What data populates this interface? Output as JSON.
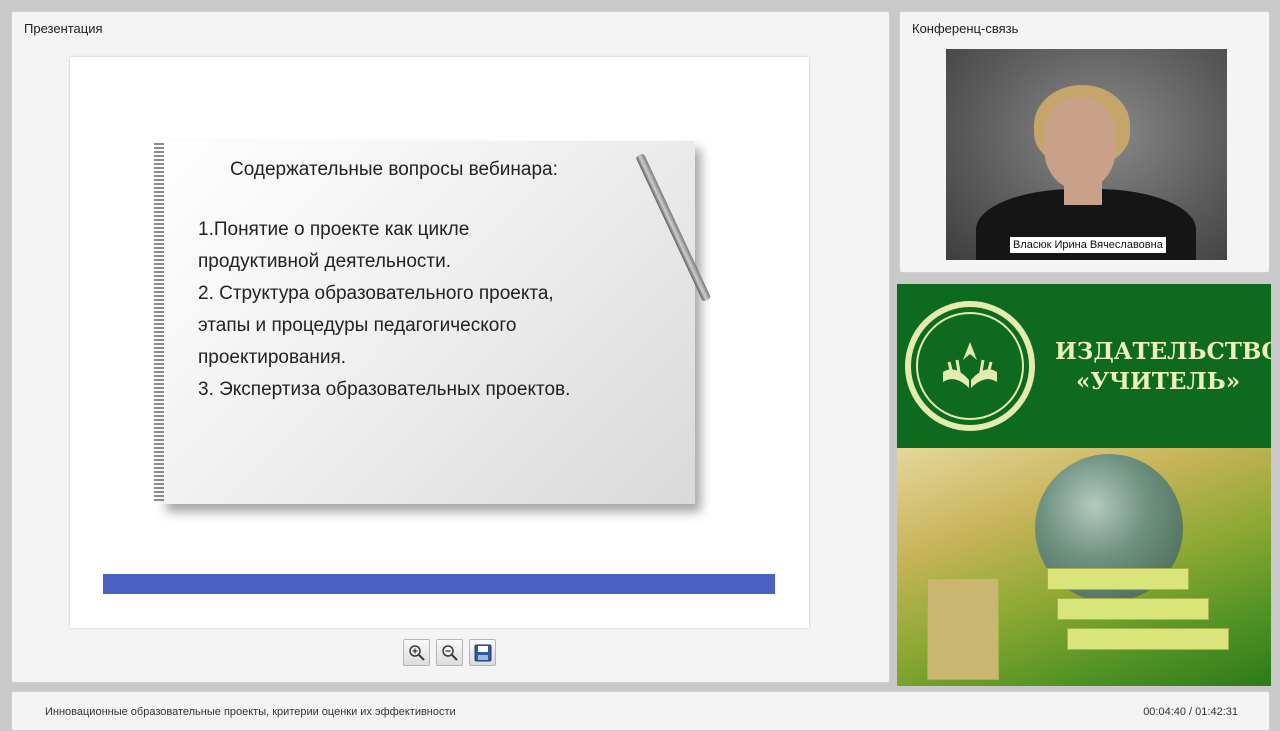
{
  "presentation": {
    "title": "Презентация"
  },
  "slide": {
    "heading": "Содержательные вопросы вебинара:",
    "lines": [
      "1.Понятие о проекте как цикле",
      "продуктивной деятельности.",
      "2. Структура образовательного проекта,",
      "этапы и процедуры педагогического",
      "проектирования.",
      "3. Экспертиза образовательных проектов."
    ],
    "bar_color": "#4c60c1"
  },
  "toolbar": {
    "zoom_in_icon": "zoom-in-icon",
    "zoom_out_icon": "zoom-out-icon",
    "save_icon": "save-icon"
  },
  "conference": {
    "title": "Конференц-связь",
    "speaker_name": "Власюк Ирина Вячеславовна"
  },
  "banner": {
    "publisher_line1": "ИЗДАТЕЛЬСТВО",
    "publisher_line2": "«УЧИТЕЛЬ»",
    "brand_color": "#0e6a1f"
  },
  "footer": {
    "course_title": "Инновационные образовательные проекты, критерии оценки их эффективности",
    "timecode": "00:04:40 / 01:42:31"
  }
}
